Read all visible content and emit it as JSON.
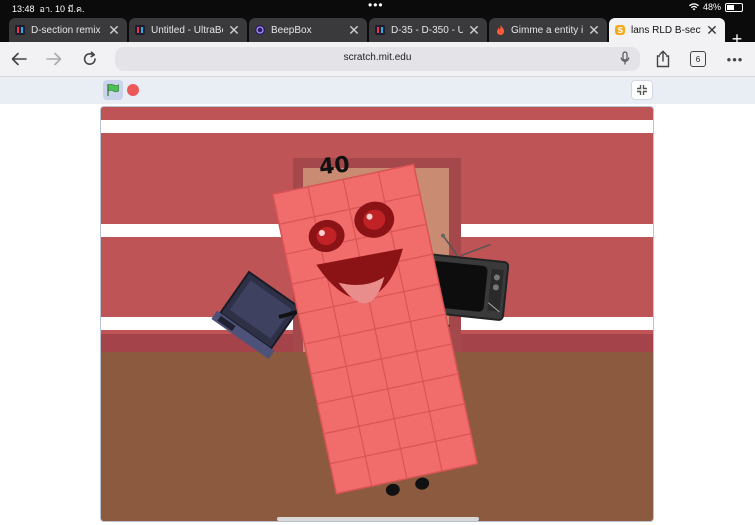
{
  "status_bar": {
    "time": "13:48",
    "date": "อา. 10 มี.ค.",
    "battery": "48%",
    "battery_level": 0.48
  },
  "tabs": [
    {
      "label": "D-section remix i",
      "favicon": "ultrabox-icon",
      "active": false
    },
    {
      "label": "Untitled - UltraBo",
      "favicon": "ultrabox-icon",
      "active": false
    },
    {
      "label": "BeepBox",
      "favicon": "beepbox-icon",
      "active": false
    },
    {
      "label": "D-35 - D-350 - U",
      "favicon": "ultrabox-icon",
      "active": false
    },
    {
      "label": "Gimme a entity in",
      "favicon": "fire-icon",
      "active": false
    },
    {
      "label": "lans RLD B-sectio",
      "favicon": "scratch-icon",
      "active": true
    }
  ],
  "toolbar": {
    "url": "scratch.mit.edu",
    "tab_count": "6"
  },
  "stage": {
    "number_label": "40"
  },
  "colors": {
    "wall": "#bf5456",
    "floor": "#8b5a3f",
    "block": "#f06d6b",
    "door": "#c98b72",
    "accent_stop": "#ec5959",
    "flag": "#4cbf56"
  }
}
